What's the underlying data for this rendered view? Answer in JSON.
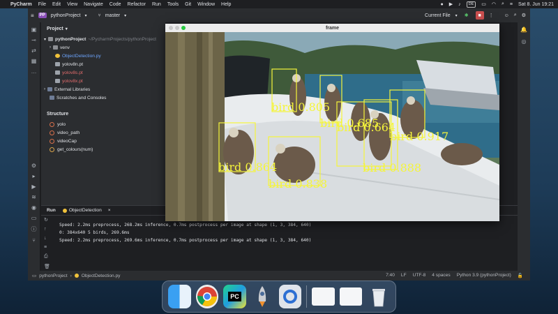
{
  "menubar": {
    "app_name": "PyCharm",
    "menus": [
      "File",
      "Edit",
      "View",
      "Navigate",
      "Code",
      "Refactor",
      "Run",
      "Tools",
      "Git",
      "Window",
      "Help"
    ],
    "keyboard": "DE",
    "datetime": "Sat 8. Jun 19:21"
  },
  "ide": {
    "project_badge": "PP",
    "project_name": "pythonProject",
    "branch": "master",
    "run_config": "Current File"
  },
  "project_panel": {
    "title": "Project",
    "root_name": "pythonProject",
    "root_path": "~/PycharmProjects/pythonProject",
    "items": [
      {
        "label": "venv"
      },
      {
        "label": "ObjectDetection.py"
      },
      {
        "label": "yolov8n.pt"
      },
      {
        "label": "yolov8s.pt"
      },
      {
        "label": "yolov8x.pt"
      },
      {
        "label": "External Libraries"
      },
      {
        "label": "Scratches and Consoles"
      }
    ]
  },
  "structure_panel": {
    "title": "Structure",
    "items": [
      "yolo",
      "video_path",
      "videoCap",
      "get_colours(num)"
    ]
  },
  "frame_window": {
    "title": "frame",
    "detections": [
      {
        "label": "bird 0.805"
      },
      {
        "label": "bird 0.685"
      },
      {
        "label": "bird 0.664"
      },
      {
        "label": "bird 0.917"
      },
      {
        "label": "bird 0.864"
      },
      {
        "label": "bird 0.888"
      },
      {
        "label": "bird 0.838"
      }
    ]
  },
  "run_panel": {
    "title": "Run",
    "tab_label": "ObjectDetection",
    "console_lines": [
      "Speed: 2.2ms preprocess, 268.2ms inference, 0.7ms postprocess per image at shape (1, 3, 384, 640)",
      "",
      "0: 384x640 5 birds, 269.6ms",
      "Speed: 2.2ms preprocess, 269.6ms inference, 0.7ms postprocess per image at shape (1, 3, 384, 640)"
    ]
  },
  "statusbar": {
    "breadcrumb_project": "pythonProject",
    "breadcrumb_file": "ObjectDetection.py",
    "position": "7:40",
    "line_ending": "LF",
    "encoding": "UTF-8",
    "indent": "4 spaces",
    "interpreter": "Python 3.9 (pythonProject)"
  },
  "dock": {
    "items": [
      "finder-icon",
      "chrome-icon",
      "pycharm-icon",
      "launchpad-icon",
      "quicktime-icon",
      "preview-window-icon",
      "preview-window-icon",
      "trash-icon"
    ],
    "pycharm_text": "PC"
  }
}
